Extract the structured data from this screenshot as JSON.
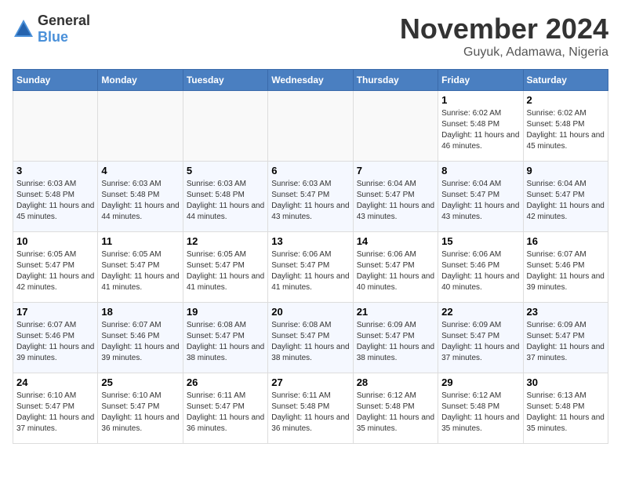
{
  "logo": {
    "general": "General",
    "blue": "Blue"
  },
  "title": "November 2024",
  "location": "Guyuk, Adamawa, Nigeria",
  "weekdays": [
    "Sunday",
    "Monday",
    "Tuesday",
    "Wednesday",
    "Thursday",
    "Friday",
    "Saturday"
  ],
  "weeks": [
    [
      {
        "day": "",
        "info": ""
      },
      {
        "day": "",
        "info": ""
      },
      {
        "day": "",
        "info": ""
      },
      {
        "day": "",
        "info": ""
      },
      {
        "day": "",
        "info": ""
      },
      {
        "day": "1",
        "info": "Sunrise: 6:02 AM\nSunset: 5:48 PM\nDaylight: 11 hours and 46 minutes."
      },
      {
        "day": "2",
        "info": "Sunrise: 6:02 AM\nSunset: 5:48 PM\nDaylight: 11 hours and 45 minutes."
      }
    ],
    [
      {
        "day": "3",
        "info": "Sunrise: 6:03 AM\nSunset: 5:48 PM\nDaylight: 11 hours and 45 minutes."
      },
      {
        "day": "4",
        "info": "Sunrise: 6:03 AM\nSunset: 5:48 PM\nDaylight: 11 hours and 44 minutes."
      },
      {
        "day": "5",
        "info": "Sunrise: 6:03 AM\nSunset: 5:48 PM\nDaylight: 11 hours and 44 minutes."
      },
      {
        "day": "6",
        "info": "Sunrise: 6:03 AM\nSunset: 5:47 PM\nDaylight: 11 hours and 43 minutes."
      },
      {
        "day": "7",
        "info": "Sunrise: 6:04 AM\nSunset: 5:47 PM\nDaylight: 11 hours and 43 minutes."
      },
      {
        "day": "8",
        "info": "Sunrise: 6:04 AM\nSunset: 5:47 PM\nDaylight: 11 hours and 43 minutes."
      },
      {
        "day": "9",
        "info": "Sunrise: 6:04 AM\nSunset: 5:47 PM\nDaylight: 11 hours and 42 minutes."
      }
    ],
    [
      {
        "day": "10",
        "info": "Sunrise: 6:05 AM\nSunset: 5:47 PM\nDaylight: 11 hours and 42 minutes."
      },
      {
        "day": "11",
        "info": "Sunrise: 6:05 AM\nSunset: 5:47 PM\nDaylight: 11 hours and 41 minutes."
      },
      {
        "day": "12",
        "info": "Sunrise: 6:05 AM\nSunset: 5:47 PM\nDaylight: 11 hours and 41 minutes."
      },
      {
        "day": "13",
        "info": "Sunrise: 6:06 AM\nSunset: 5:47 PM\nDaylight: 11 hours and 41 minutes."
      },
      {
        "day": "14",
        "info": "Sunrise: 6:06 AM\nSunset: 5:47 PM\nDaylight: 11 hours and 40 minutes."
      },
      {
        "day": "15",
        "info": "Sunrise: 6:06 AM\nSunset: 5:46 PM\nDaylight: 11 hours and 40 minutes."
      },
      {
        "day": "16",
        "info": "Sunrise: 6:07 AM\nSunset: 5:46 PM\nDaylight: 11 hours and 39 minutes."
      }
    ],
    [
      {
        "day": "17",
        "info": "Sunrise: 6:07 AM\nSunset: 5:46 PM\nDaylight: 11 hours and 39 minutes."
      },
      {
        "day": "18",
        "info": "Sunrise: 6:07 AM\nSunset: 5:46 PM\nDaylight: 11 hours and 39 minutes."
      },
      {
        "day": "19",
        "info": "Sunrise: 6:08 AM\nSunset: 5:47 PM\nDaylight: 11 hours and 38 minutes."
      },
      {
        "day": "20",
        "info": "Sunrise: 6:08 AM\nSunset: 5:47 PM\nDaylight: 11 hours and 38 minutes."
      },
      {
        "day": "21",
        "info": "Sunrise: 6:09 AM\nSunset: 5:47 PM\nDaylight: 11 hours and 38 minutes."
      },
      {
        "day": "22",
        "info": "Sunrise: 6:09 AM\nSunset: 5:47 PM\nDaylight: 11 hours and 37 minutes."
      },
      {
        "day": "23",
        "info": "Sunrise: 6:09 AM\nSunset: 5:47 PM\nDaylight: 11 hours and 37 minutes."
      }
    ],
    [
      {
        "day": "24",
        "info": "Sunrise: 6:10 AM\nSunset: 5:47 PM\nDaylight: 11 hours and 37 minutes."
      },
      {
        "day": "25",
        "info": "Sunrise: 6:10 AM\nSunset: 5:47 PM\nDaylight: 11 hours and 36 minutes."
      },
      {
        "day": "26",
        "info": "Sunrise: 6:11 AM\nSunset: 5:47 PM\nDaylight: 11 hours and 36 minutes."
      },
      {
        "day": "27",
        "info": "Sunrise: 6:11 AM\nSunset: 5:48 PM\nDaylight: 11 hours and 36 minutes."
      },
      {
        "day": "28",
        "info": "Sunrise: 6:12 AM\nSunset: 5:48 PM\nDaylight: 11 hours and 35 minutes."
      },
      {
        "day": "29",
        "info": "Sunrise: 6:12 AM\nSunset: 5:48 PM\nDaylight: 11 hours and 35 minutes."
      },
      {
        "day": "30",
        "info": "Sunrise: 6:13 AM\nSunset: 5:48 PM\nDaylight: 11 hours and 35 minutes."
      }
    ]
  ]
}
